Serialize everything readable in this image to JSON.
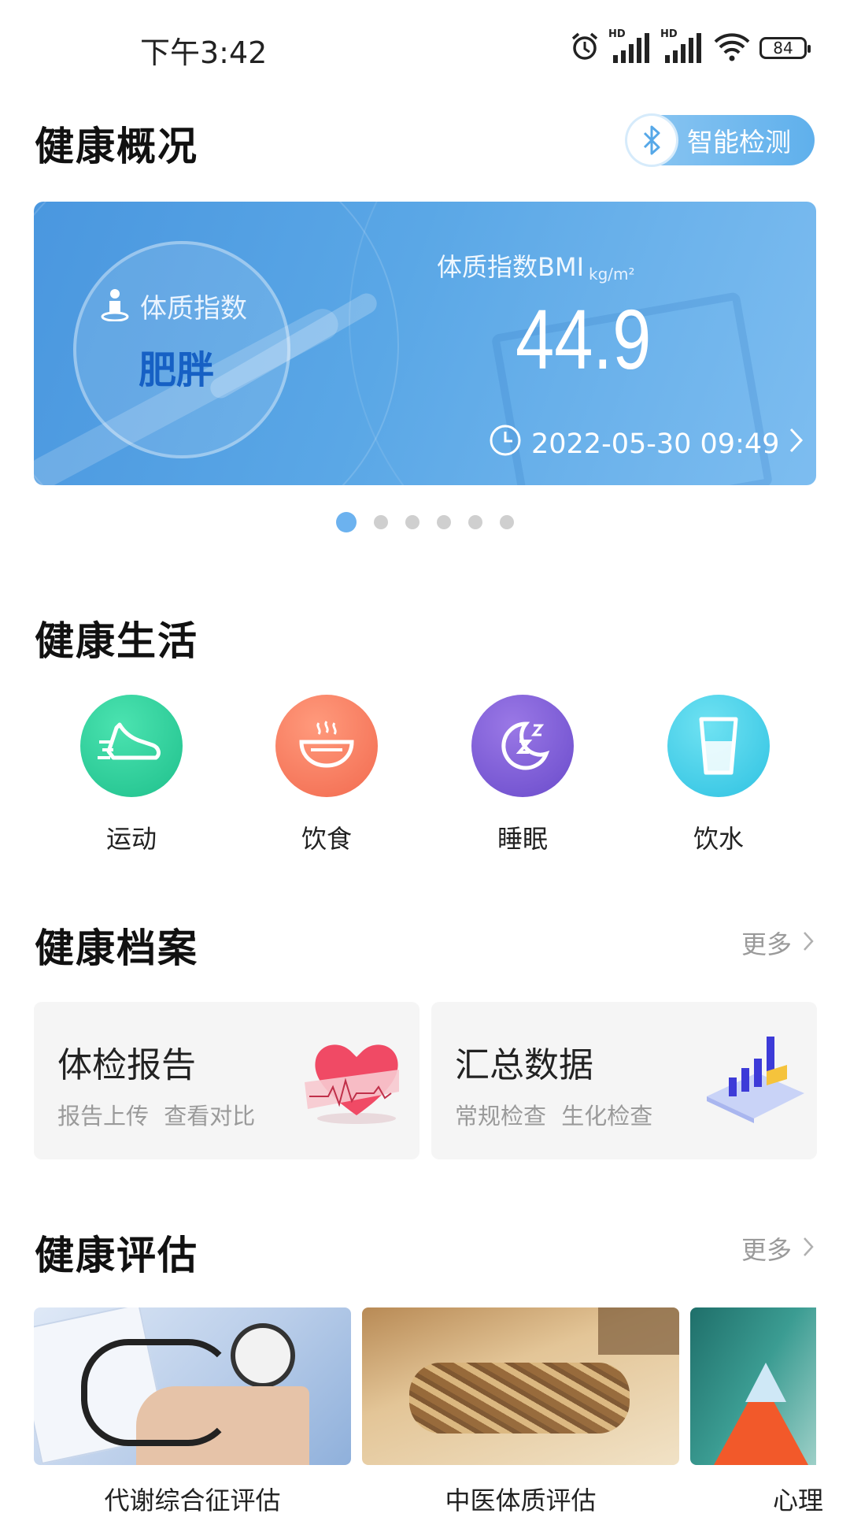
{
  "status_bar": {
    "time": "下午3:42",
    "hd": "HD",
    "battery": "84"
  },
  "overview": {
    "title": "健康概况",
    "smart_detect": "智能检测",
    "banner": {
      "index_label": "体质指数",
      "index_status": "肥胖",
      "bmi_title": "体质指数BMI",
      "bmi_unit": "kg/m²",
      "bmi_value": "44.9",
      "timestamp": "2022-05-30 09:49"
    },
    "pagination": {
      "count": 6,
      "active": 0
    }
  },
  "life": {
    "title": "健康生活",
    "items": [
      {
        "label": "运动",
        "icon": "running-shoe-icon",
        "color": "#2fd39a"
      },
      {
        "label": "饮食",
        "icon": "bowl-icon",
        "color": "#f77a5e"
      },
      {
        "label": "睡眠",
        "icon": "moon-sleep-icon",
        "color": "#7a5ad6"
      },
      {
        "label": "饮水",
        "icon": "water-glass-icon",
        "color": "#3fcde8"
      }
    ]
  },
  "archive": {
    "title": "健康档案",
    "more": "更多",
    "cards": [
      {
        "title": "体检报告",
        "subtitle": "报告上传  查看对比",
        "icon": "heart-ecg-icon"
      },
      {
        "title": "汇总数据",
        "subtitle": "常规检查  生化检查",
        "icon": "bar-chart-3d-icon"
      }
    ]
  },
  "assessment": {
    "title": "健康评估",
    "more": "更多",
    "items": [
      {
        "label": "代谢综合征评估"
      },
      {
        "label": "中医体质评估"
      },
      {
        "label": "心理"
      }
    ]
  }
}
